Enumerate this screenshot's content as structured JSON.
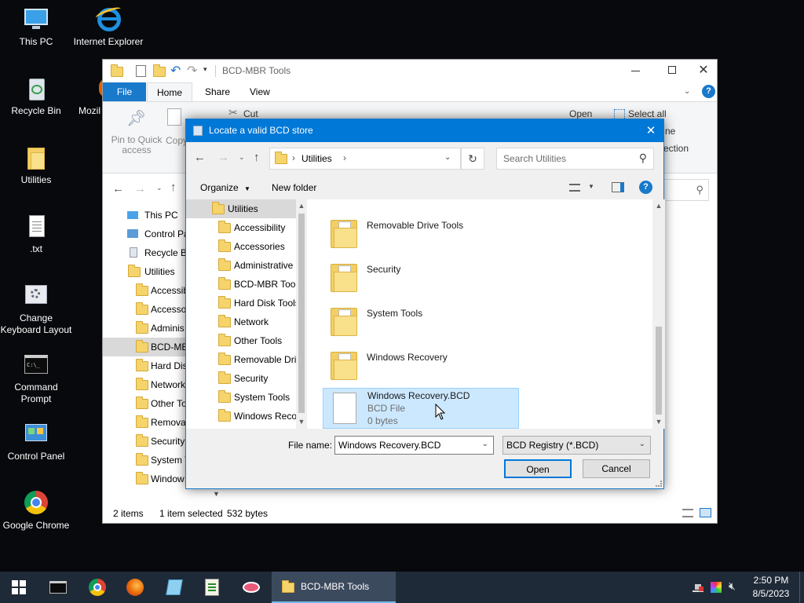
{
  "desktop": {
    "icons": [
      {
        "label": "This PC"
      },
      {
        "label": "Internet Explorer"
      },
      {
        "label": "Recycle Bin"
      },
      {
        "label": "Mozil"
      },
      {
        "label": "Utilities"
      },
      {
        "label": ".txt"
      },
      {
        "label": "Change Keyboard Layout"
      },
      {
        "label": "Command Prompt"
      },
      {
        "label": "Control Panel"
      },
      {
        "label": "Google Chrome"
      }
    ]
  },
  "explorer": {
    "title": "BCD-MBR Tools",
    "tabs": {
      "file": "File",
      "home": "Home",
      "share": "Share",
      "view": "View"
    },
    "ribbon": {
      "pin_label": "Pin to Quick access",
      "copy_label": "Copy",
      "cut_label": "Cut",
      "open_label": "Open",
      "select_all_label": "Select all",
      "right_partial_1": "ne",
      "right_partial_2": "ection"
    },
    "tree": [
      {
        "label": "This PC"
      },
      {
        "label": "Control Pa"
      },
      {
        "label": "Recycle Bi"
      },
      {
        "label": "Utilities"
      },
      {
        "label": "Accessib"
      },
      {
        "label": "Accesso"
      },
      {
        "label": "Adminis"
      },
      {
        "label": "BCD-ME"
      },
      {
        "label": "Hard Dis"
      },
      {
        "label": "Network"
      },
      {
        "label": "Other To"
      },
      {
        "label": "Remova"
      },
      {
        "label": "Security"
      },
      {
        "label": "System T"
      },
      {
        "label": "Window"
      }
    ],
    "status": {
      "items": "2 items",
      "selected": "1 item selected",
      "size": "532 bytes"
    }
  },
  "dialog": {
    "title": "Locate a valid BCD store",
    "breadcrumb": "Utilities",
    "search_placeholder": "Search Utilities",
    "organize_label": "Organize",
    "new_folder_label": "New folder",
    "tree": [
      {
        "label": "Utilities"
      },
      {
        "label": "Accessibility"
      },
      {
        "label": "Accessories"
      },
      {
        "label": "Administrative"
      },
      {
        "label": "BCD-MBR Tool"
      },
      {
        "label": "Hard Disk Tools"
      },
      {
        "label": "Network"
      },
      {
        "label": "Other Tools"
      },
      {
        "label": "Removable Dri"
      },
      {
        "label": "Security"
      },
      {
        "label": "System Tools"
      },
      {
        "label": "Windows Reco"
      }
    ],
    "files": [
      {
        "name": "Removable Drive Tools"
      },
      {
        "name": "Security"
      },
      {
        "name": "System Tools"
      },
      {
        "name": "Windows Recovery"
      }
    ],
    "selected_file": {
      "name": "Windows Recovery.BCD",
      "type": "BCD File",
      "size": "0 bytes"
    },
    "file_name_label": "File name:",
    "file_name_value": "Windows Recovery.BCD",
    "filter_value": "BCD Registry (*.BCD)",
    "open_button": "Open",
    "cancel_button": "Cancel"
  },
  "taskbar": {
    "active_window": "BCD-MBR Tools",
    "time": "2:50 PM",
    "date": "8/5/2023"
  },
  "colors": {
    "accent": "#0078d7",
    "selection": "#cce8ff",
    "taskbar": "#1f2a38"
  }
}
